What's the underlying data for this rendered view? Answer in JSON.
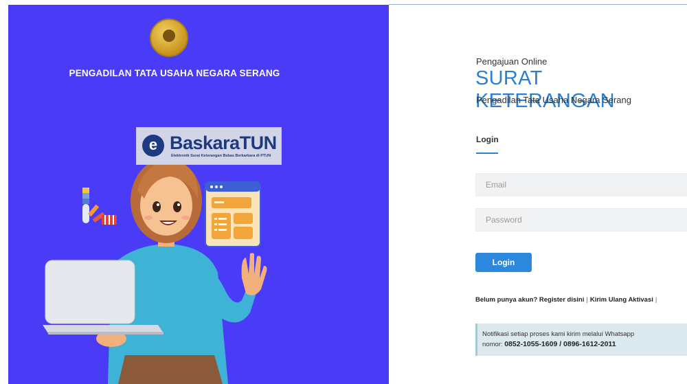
{
  "left": {
    "org_title": "PENGADILAN TATA USAHA NEGARA SERANG",
    "brand_letter": "e",
    "brand_name": "BaskaraTUN",
    "brand_tagline": "Elektronik Surat Keterangan Bebas Berkarkara di PTUN"
  },
  "header": {
    "kicker": "Pengajuan Online",
    "title": "SURAT KETERANGAN",
    "subtitle": "Pengadilan Tata Usaha Negara Serang"
  },
  "login": {
    "tab_label": "Login",
    "email_placeholder": "Email",
    "password_placeholder": "Password",
    "submit_label": "Login"
  },
  "links": {
    "register": "Belum punya akun? Register disini",
    "resend": "Kirim Ulang Aktivasi",
    "separator": "|"
  },
  "notice": {
    "text": "Notifikasi setiap proses kami kirim melalui Whatsapp",
    "prefix": "nomor: ",
    "numbers": "0852-1055-1609 / 0896-1612-2011"
  },
  "colors": {
    "panel_bg": "#4a3cf6",
    "accent": "#2b7fd0",
    "button": "#2b88dc",
    "notice_bg": "#dce9ee"
  }
}
